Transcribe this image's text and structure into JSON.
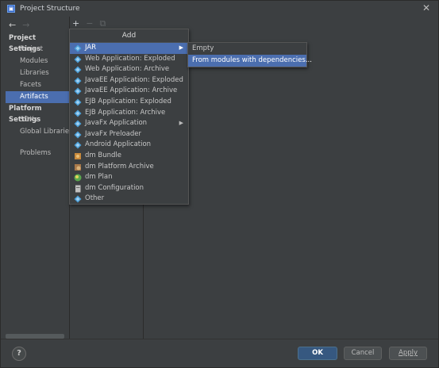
{
  "window": {
    "title": "Project Structure",
    "close": "✕"
  },
  "nav": {
    "back": "←",
    "forward": "→"
  },
  "toolbar": {
    "add": "+",
    "remove": "−",
    "copy": "⧉"
  },
  "sidebar": {
    "project_settings": {
      "header": "Project Settings",
      "items": [
        "Project",
        "Modules",
        "Libraries",
        "Facets",
        "Artifacts"
      ]
    },
    "platform_settings": {
      "header": "Platform Settings",
      "items": [
        "SDKs",
        "Global Libraries"
      ]
    },
    "problems": "Problems",
    "selected": "Artifacts"
  },
  "add_popup": {
    "header": "Add",
    "items": [
      {
        "label": "JAR",
        "icon": "diamond-icon",
        "submenu": true,
        "selected": true
      },
      {
        "label": "Web Application: Exploded",
        "icon": "diamond-icon"
      },
      {
        "label": "Web Application: Archive",
        "icon": "diamond-icon"
      },
      {
        "label": "JavaEE Application: Exploded",
        "icon": "diamond-icon"
      },
      {
        "label": "JavaEE Application: Archive",
        "icon": "diamond-icon"
      },
      {
        "label": "EJB Application: Exploded",
        "icon": "diamond-icon"
      },
      {
        "label": "EJB Application: Archive",
        "icon": "diamond-icon"
      },
      {
        "label": "JavaFx Application",
        "icon": "diamond-icon",
        "submenu": true
      },
      {
        "label": "JavaFx Preloader",
        "icon": "diamond-icon"
      },
      {
        "label": "Android Application",
        "icon": "diamond-icon"
      },
      {
        "label": "dm Bundle",
        "icon": "bundle-icon"
      },
      {
        "label": "dm Platform Archive",
        "icon": "archive-icon"
      },
      {
        "label": "dm Plan",
        "icon": "plan-icon"
      },
      {
        "label": "dm Configuration",
        "icon": "config-icon"
      },
      {
        "label": "Other",
        "icon": "diamond-icon"
      }
    ]
  },
  "jar_submenu": {
    "items": [
      {
        "label": "Empty"
      },
      {
        "label": "From modules with dependencies...",
        "selected": true
      }
    ]
  },
  "buttons": {
    "help": "?",
    "ok": "OK",
    "cancel": "Cancel",
    "apply": "Apply"
  },
  "colors": {
    "background": "#3c3f41",
    "selection": "#4b6eaf",
    "ok_button": "#365880",
    "icon_diamond": "#4a9fd8"
  }
}
